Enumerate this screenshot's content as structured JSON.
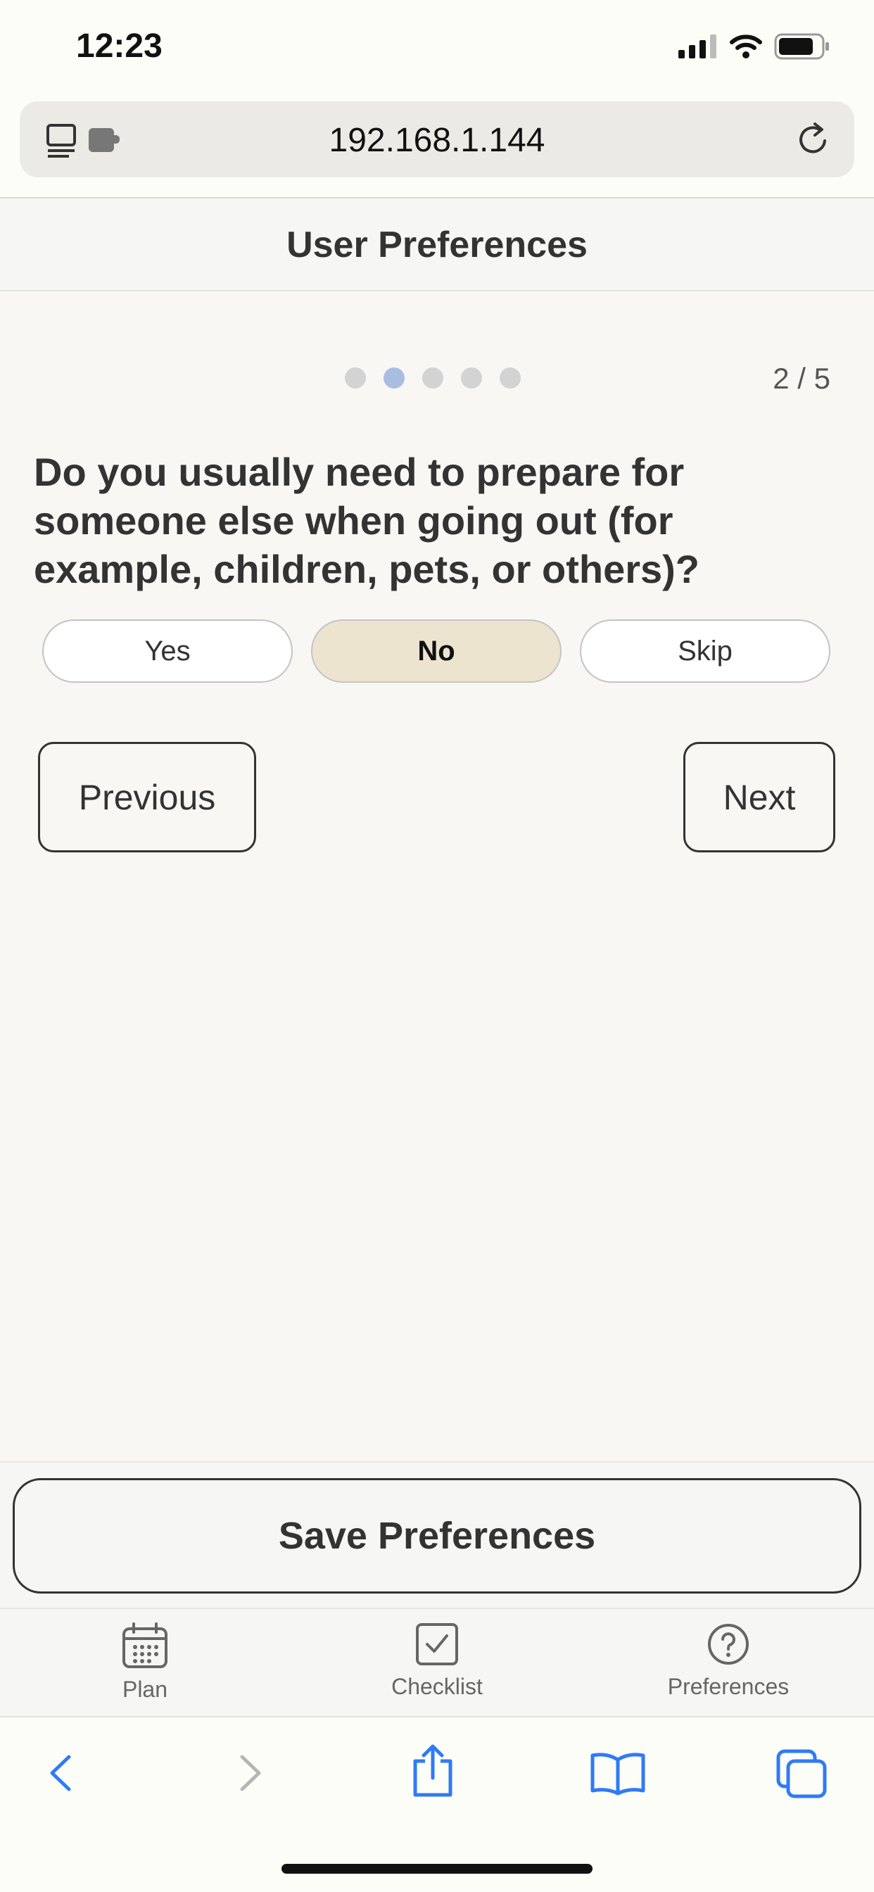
{
  "status_bar": {
    "time": "12:23"
  },
  "browser": {
    "url": "192.168.1.144"
  },
  "header": {
    "title": "User Preferences"
  },
  "progress": {
    "current": 2,
    "total": 5,
    "label": "2 / 5"
  },
  "question": {
    "text": "Do you usually need to prepare for someone else when going out (for example, children, pets, or others)?",
    "options": [
      "Yes",
      "No",
      "Skip"
    ],
    "selected": "No"
  },
  "nav": {
    "previous_label": "Previous",
    "next_label": "Next"
  },
  "save": {
    "label": "Save Preferences"
  },
  "tabs": [
    {
      "label": "Plan",
      "icon": "calendar-icon"
    },
    {
      "label": "Checklist",
      "icon": "checkbox-icon"
    },
    {
      "label": "Preferences",
      "icon": "question-circle-icon"
    }
  ],
  "colors": {
    "active_dot": "#a9bde3",
    "selected_option": "#ede4d0",
    "browser_blue": "#2f7bf5"
  }
}
